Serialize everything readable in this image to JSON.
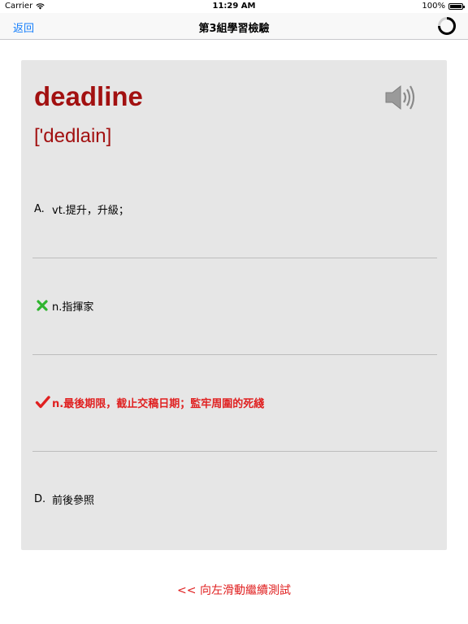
{
  "status_bar": {
    "carrier": "Carrier",
    "time": "11:29 AM",
    "battery": "100%"
  },
  "nav": {
    "back_label": "返回",
    "title": "第3組學習檢驗"
  },
  "card": {
    "word": "deadline",
    "phonetic": "['dedlain]",
    "options": [
      {
        "label": "A.",
        "text": "vt.提升，升級；",
        "state": "normal"
      },
      {
        "label": "",
        "text": "n.指揮家",
        "state": "wrong",
        "icon": "x-icon"
      },
      {
        "label": "",
        "text": "n.最後期限，截止交稿日期；監牢周圍的死綫",
        "state": "correct",
        "icon": "check-icon"
      },
      {
        "label": "D.",
        "text": "前後參照",
        "state": "normal"
      }
    ]
  },
  "footer": {
    "swipe_hint": "<< 向左滑動繼續測試"
  },
  "colors": {
    "accent_red": "#a21010",
    "correct_red": "#e02020",
    "wrong_green": "#2fb52f",
    "ios_blue": "#157efb"
  }
}
